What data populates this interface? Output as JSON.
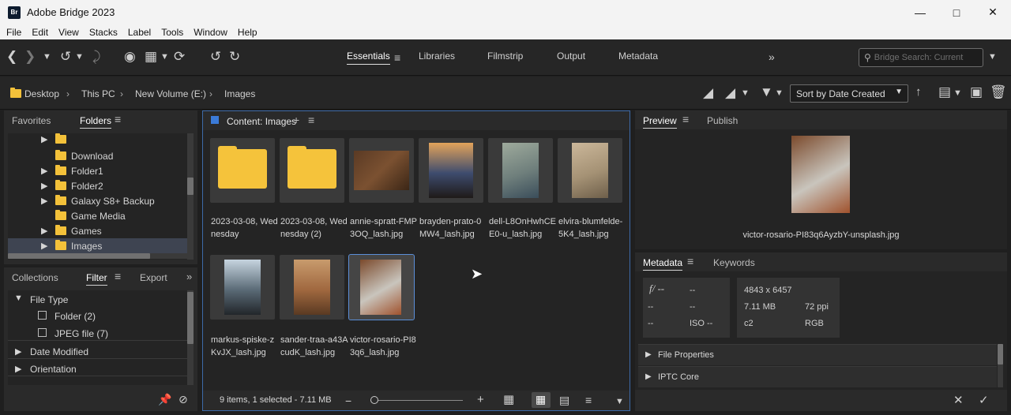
{
  "window": {
    "title": "Adobe Bridge 2023",
    "app_icon_text": "Br"
  },
  "menu": [
    "File",
    "Edit",
    "View",
    "Stacks",
    "Label",
    "Tools",
    "Window",
    "Help"
  ],
  "workspaces": [
    {
      "label": "Essentials",
      "active": true
    },
    {
      "label": "Libraries"
    },
    {
      "label": "Filmstrip"
    },
    {
      "label": "Output"
    },
    {
      "label": "Metadata"
    }
  ],
  "search": {
    "placeholder": "Bridge Search: Current"
  },
  "breadcrumb": [
    "Desktop",
    "This PC",
    "New Volume (E:)",
    "Images"
  ],
  "sort": {
    "selected": "Sort by Date Created"
  },
  "left_top_tabs": [
    "Favorites",
    "Folders"
  ],
  "folders": [
    {
      "label": "",
      "expandable": true
    },
    {
      "label": "Download",
      "expandable": false
    },
    {
      "label": "Folder1",
      "expandable": true
    },
    {
      "label": "Folder2",
      "expandable": true
    },
    {
      "label": "Galaxy S8+ Backup",
      "expandable": true
    },
    {
      "label": "Game Media",
      "expandable": false
    },
    {
      "label": "Games",
      "expandable": true
    },
    {
      "label": "Images",
      "expandable": true,
      "selected": true
    }
  ],
  "left_bottom_tabs": [
    "Collections",
    "Filter",
    "Export"
  ],
  "filter": {
    "file_type_label": "File Type",
    "items": [
      "Folder (2)",
      "JPEG file (7)"
    ],
    "sections": [
      "Date Modified",
      "Orientation"
    ]
  },
  "content": {
    "title": "Content: Images",
    "items": [
      {
        "label": "2023-03-08, Wednesday",
        "kind": "folder"
      },
      {
        "label": "2023-03-08, Wednesday (2)",
        "kind": "folder"
      },
      {
        "label": "annie-spratt-FMP3OQ_lash.jpg",
        "kind": "image",
        "colors": [
          "#5a3a24",
          "#7b5131",
          "#3b2616"
        ]
      },
      {
        "label": "brayden-prato-0MW4_lash.jpg",
        "kind": "image",
        "colors": [
          "#e3a35a",
          "#3e4c6e",
          "#1f1a18"
        ]
      },
      {
        "label": "dell-L8OnHwhCEE0-u_lash.jpg",
        "kind": "image",
        "colors": [
          "#9eaa9c",
          "#6f7f7c",
          "#3a4d5a"
        ]
      },
      {
        "label": "elvira-blumfelde-5K4_lash.jpg",
        "kind": "image",
        "colors": [
          "#cbb79a",
          "#a59275",
          "#6e5f4a"
        ]
      },
      {
        "label": "markus-spiske-zKvJX_lash.jpg",
        "kind": "image",
        "colors": [
          "#c6d4df",
          "#5a6a76",
          "#22262a"
        ]
      },
      {
        "label": "sander-traa-a43AcudK_lash.jpg",
        "kind": "image",
        "colors": [
          "#c89b6d",
          "#a0683f",
          "#5a3a22"
        ]
      },
      {
        "label": "victor-rosario-PI83q6_lash.jpg",
        "kind": "image",
        "selected": true,
        "colors": [
          "#7b4a2c",
          "#c9c5bd",
          "#a0522d"
        ]
      }
    ],
    "status": "9 items, 1 selected - 7.11 MB"
  },
  "preview": {
    "tabs": [
      "Preview",
      "Publish"
    ],
    "filename": "victor-rosario-PI83q6AyzbY-unsplash.jpg"
  },
  "metadata": {
    "tabs": [
      "Metadata",
      "Keywords"
    ],
    "camera": [
      "f/ --",
      "--",
      "--",
      "--",
      "--",
      "ISO --"
    ],
    "file": [
      "4843 x 6457",
      "7.11 MB",
      "72 ppi",
      "c2",
      "RGB"
    ],
    "sections": [
      "File Properties",
      "IPTC Core"
    ]
  }
}
